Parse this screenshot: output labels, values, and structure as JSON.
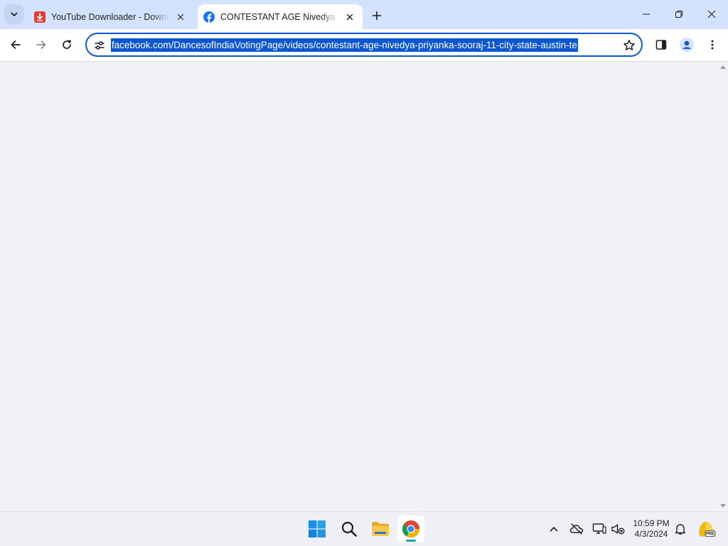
{
  "tabs": [
    {
      "title": "YouTube Downloader - Download",
      "active": false,
      "favicon": "youtube-downloader-icon"
    },
    {
      "title": "CONTESTANT AGE Nivedya Priyanka",
      "active": true,
      "favicon": "facebook-icon"
    }
  ],
  "omnibox": {
    "url": "facebook.com/DancesofIndiaVotingPage/videos/contestant-age-nivedya-priyanka-sooraj-11-city-state-austin-te"
  },
  "taskbar": {
    "time": "10:59 PM",
    "date": "4/3/2024",
    "copilot_badge": "PRE"
  },
  "colors": {
    "tabstrip": "#d3e3fd",
    "accent": "#0b57d0",
    "page_bg": "#f0f2f5",
    "facebook": "#1877f2"
  }
}
